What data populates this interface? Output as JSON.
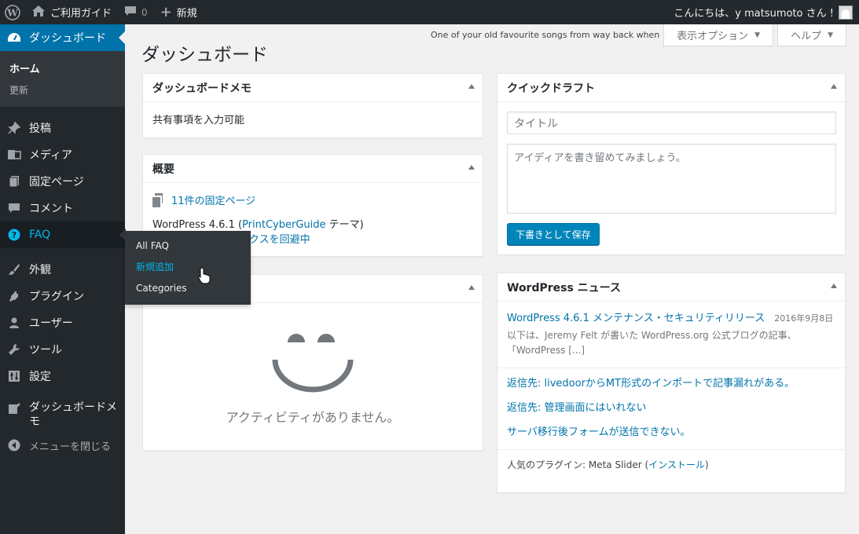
{
  "adminbar": {
    "site_name": "ご利用ガイド",
    "comments_count": "0",
    "new_label": "新規",
    "greeting": "こんにちは、y matsumoto さん !"
  },
  "sidebar": {
    "dashboard": "ダッシュボード",
    "home": "ホーム",
    "update": "更新",
    "items": [
      {
        "label": "投稿",
        "icon": "pin-icon"
      },
      {
        "label": "メディア",
        "icon": "media-icon"
      },
      {
        "label": "固定ページ",
        "icon": "pages-icon"
      },
      {
        "label": "コメント",
        "icon": "comment-icon"
      },
      {
        "label": "FAQ",
        "icon": "question-icon"
      },
      {
        "label": "外観",
        "icon": "brush-icon"
      },
      {
        "label": "プラグイン",
        "icon": "plugin-icon"
      },
      {
        "label": "ユーザー",
        "icon": "user-icon"
      },
      {
        "label": "ツール",
        "icon": "wrench-icon"
      },
      {
        "label": "設定",
        "icon": "settings-icon"
      },
      {
        "label": "ダッシュボードメモ",
        "icon": "memo-icon"
      }
    ],
    "collapse": "メニューを閉じる"
  },
  "flyout": {
    "items": [
      "All FAQ",
      "新規追加",
      "Categories"
    ]
  },
  "hello_dolly": "One of your old favourite songs from way back when",
  "screen_options": "表示オプション",
  "help": "ヘルプ",
  "page_title": "ダッシュボード",
  "memo": {
    "title": "ダッシュボードメモ",
    "body": "共有事項を入力可能"
  },
  "glance": {
    "title": "概要",
    "pages": "11件の固定ページ",
    "wp_prefix": "WordPress 4.6.1 (",
    "theme_link": "PrintCyberGuide",
    "wp_suffix": " テーマ)",
    "spam_link": "ックスを回避中"
  },
  "activity": {
    "empty": "アクティビティがありません。"
  },
  "draft": {
    "title": "クイックドラフト",
    "title_placeholder": "タイトル",
    "body_placeholder": "アイディアを書き留めてみましょう。",
    "save": "下書きとして保存"
  },
  "news": {
    "title": "WordPress ニュース",
    "headline": "WordPress 4.6.1 メンテナンス・セキュリティリリース",
    "date": "2016年9月8日",
    "excerpt": "以下は、Jeremy Felt が書いた WordPress.org 公式ブログの記事、「WordPress [...]",
    "links": [
      "返信先: livedoorからMT形式のインポートで記事漏れがある。",
      "返信先: 管理画面にはいれない",
      "サーバ移行後フォームが送信できない。"
    ],
    "popular_prefix": "人気のプラグイン: Meta Slider (",
    "popular_link": "インストール",
    "popular_suffix": ")"
  },
  "colors": {
    "sidebar_bg": "#23282d",
    "accent": "#0073aa",
    "highlight": "#00b9eb"
  }
}
